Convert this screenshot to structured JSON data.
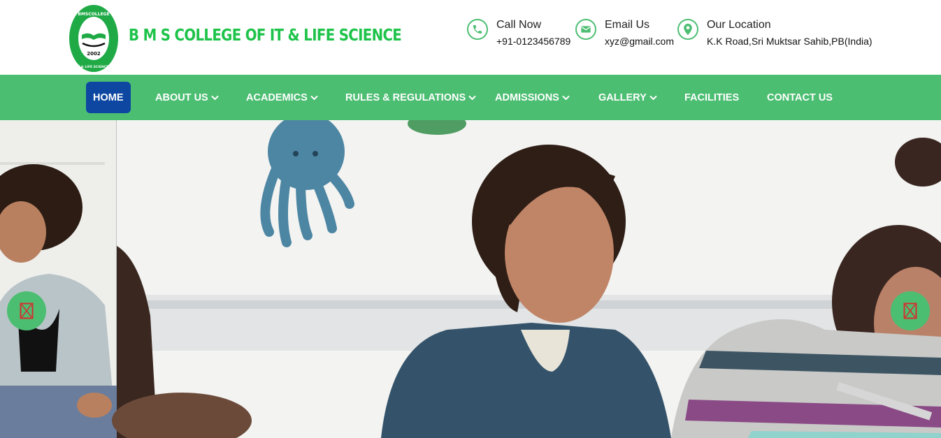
{
  "brand": {
    "name": "B M S COLLEGE OF IT & LIFE SCIENCE",
    "logo": {
      "ring_top": "BMSCOLLEGE",
      "ring_bottom": "IT & LIFE SCIENCES",
      "year": "2002"
    }
  },
  "contact": [
    {
      "icon": "phone-icon",
      "title": "Call Now",
      "value": "+91-0123456789"
    },
    {
      "icon": "envelope-icon",
      "title": "Email Us",
      "value": "xyz@gmail.com"
    },
    {
      "icon": "location-pin-icon",
      "title": "Our Location",
      "value": "K.K Road,Sri Muktsar Sahib,PB(India)"
    }
  ],
  "nav": [
    {
      "label": "HOME",
      "active": true
    },
    {
      "label": "ABOUT US",
      "dropdown": true
    },
    {
      "label": "ACADEMICS",
      "dropdown": true
    },
    {
      "label": "RULES & REGULATIONS",
      "dropdown": true
    },
    {
      "label": "ADMISSIONS",
      "dropdown": true
    },
    {
      "label": "GALLERY",
      "dropdown": true
    },
    {
      "label": "FACILITIES"
    },
    {
      "label": "CONTACT US"
    }
  ],
  "colors": {
    "primary_green": "#4cbe72",
    "brand_green": "#1ec34a",
    "active_nav": "#0d47a1",
    "broken_icon_red": "#d32f2f"
  },
  "slider": {
    "prev_icon": "broken-image-icon",
    "next_icon": "broken-image-icon"
  }
}
